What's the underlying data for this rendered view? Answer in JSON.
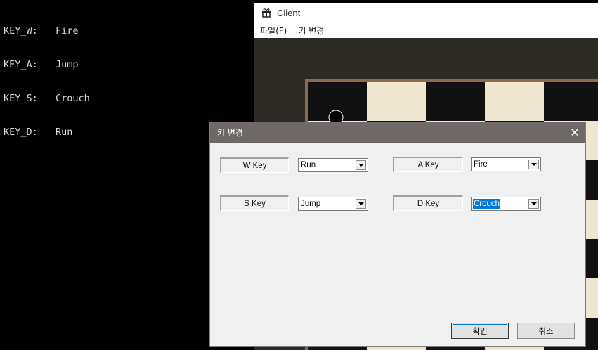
{
  "console": {
    "lines": [
      {
        "key": "KEY_W:",
        "value": "Fire"
      },
      {
        "key": "KEY_A:",
        "value": "Jump"
      },
      {
        "key": "KEY_S:",
        "value": "Crouch"
      },
      {
        "key": "KEY_D:",
        "value": "Run"
      }
    ]
  },
  "client": {
    "title": "Client",
    "icon": "gift-icon",
    "menu": [
      {
        "label": "파일(F)"
      },
      {
        "label": "키 변경"
      }
    ]
  },
  "dialog": {
    "title": "키 변경",
    "close_icon": "close-icon",
    "bindings": [
      {
        "key_label": "W Key",
        "action": "Run"
      },
      {
        "key_label": "A Key",
        "action": "Fire"
      },
      {
        "key_label": "S Key",
        "action": "Jump"
      },
      {
        "key_label": "D Key",
        "action": "Crouch"
      }
    ],
    "ok_label": "확인",
    "cancel_label": "취소"
  },
  "colors": {
    "dialog_titlebar": "#6e6966",
    "selection": "#0078d7"
  }
}
